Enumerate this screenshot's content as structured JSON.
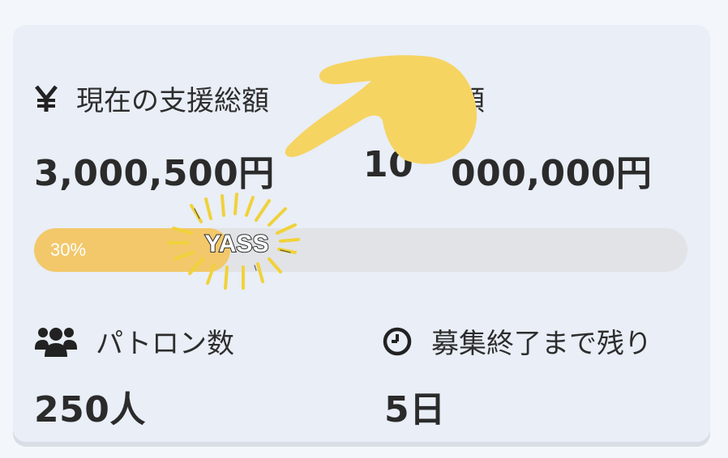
{
  "card": {
    "current_total": {
      "icon": "yen-icon",
      "label": "現在の支援総額",
      "value": "3,000,500円"
    },
    "goal": {
      "label_visible_part": "額",
      "value_visible_prefix": "10",
      "value_visible_suffix": "000,000円"
    },
    "progress": {
      "percent_label": "30%",
      "fraction": 0.3
    },
    "patrons": {
      "icon": "users-icon",
      "label": "パトロン数",
      "value": "250人"
    },
    "time_left": {
      "icon": "clock-icon",
      "label": "募集終了まで残り",
      "value": "5日"
    }
  },
  "stickers": {
    "pointing_hand": {
      "icon": "pointing-hand-icon",
      "color": "#f6d462"
    },
    "yass": {
      "text": "YASS",
      "ray_color": "#f0d23a"
    }
  },
  "colors": {
    "card_bg": "#e9eef7",
    "progress_fill": "#f2c86a",
    "progress_track": "#e2e3e7",
    "text": "#2d2d2d"
  }
}
